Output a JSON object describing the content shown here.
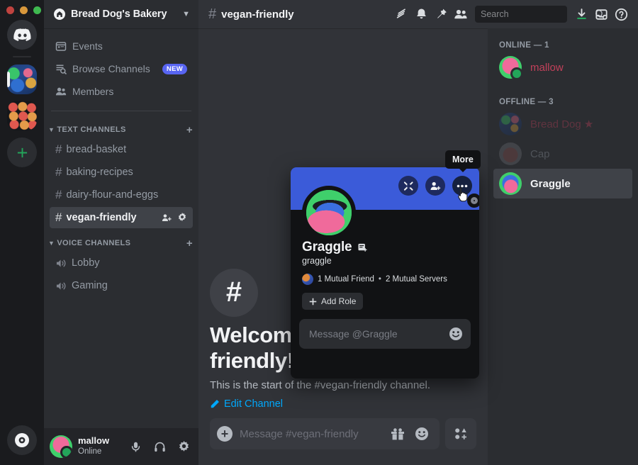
{
  "window": {
    "traffic_lights": [
      "close",
      "minimize",
      "maximize"
    ]
  },
  "server_rail": {
    "items": [
      {
        "name": "discord-home",
        "label": "Discord"
      },
      {
        "name": "server-bread-dogs-bakery",
        "label": "Bread Dog's Bakery",
        "active": true
      },
      {
        "name": "server-cookies",
        "label": "Cookies"
      },
      {
        "name": "add-server",
        "label": "Add a Server"
      },
      {
        "name": "explore-servers",
        "label": "Explore Discoverable Servers"
      }
    ]
  },
  "sidebar": {
    "server_name": "Bread Dog's Bakery",
    "nav": [
      {
        "label": "Events",
        "icon": "calendar-icon"
      },
      {
        "label": "Browse Channels",
        "icon": "browse-icon",
        "badge": "NEW"
      },
      {
        "label": "Members",
        "icon": "members-icon"
      }
    ],
    "categories": [
      {
        "label": "TEXT CHANNELS",
        "channels": [
          {
            "name": "bread-basket",
            "active": false
          },
          {
            "name": "baking-recipes",
            "active": false
          },
          {
            "name": "dairy-flour-and-eggs",
            "active": false
          },
          {
            "name": "vegan-friendly",
            "active": true
          }
        ]
      },
      {
        "label": "VOICE CHANNELS",
        "channels": [
          {
            "name": "Lobby",
            "active": false
          },
          {
            "name": "Gaming",
            "active": false
          }
        ]
      }
    ],
    "user_panel": {
      "username": "mallow",
      "status": "Online",
      "buttons": [
        "microphone-icon",
        "headphones-icon",
        "settings-icon"
      ]
    }
  },
  "topbar": {
    "channel": "vegan-friendly",
    "icons": [
      "threads-icon",
      "notification-bell-icon",
      "pinned-messages-icon",
      "member-list-icon"
    ],
    "search": {
      "placeholder": "Search",
      "value": ""
    },
    "right_icons": [
      "inbox-download-icon",
      "inbox-icon",
      "help-icon"
    ]
  },
  "main": {
    "welcome_title": "Welcome to #vegan-friendly!",
    "welcome_subtitle": "This is the start of the #vegan-friendly channel.",
    "edit_channel": "Edit Channel",
    "composer": {
      "placeholder": "Message #vegan-friendly",
      "icons": [
        "gift-icon",
        "emoji-icon",
        "apps-icon"
      ]
    }
  },
  "members": {
    "groups": [
      {
        "heading": "ONLINE — 1",
        "items": [
          {
            "name": "mallow",
            "color": "#c2405a",
            "avatar": "av-mallow",
            "online": true,
            "selected": false,
            "dim": false
          }
        ]
      },
      {
        "heading": "OFFLINE — 3",
        "items": [
          {
            "name": "Bread Dog ★",
            "color": "#c2405a",
            "avatar": "av-breaddog",
            "online": false,
            "selected": false,
            "dim": true
          },
          {
            "name": "Cap",
            "color": "#949ba4",
            "avatar": "av-cap",
            "online": false,
            "selected": false,
            "dim": true
          },
          {
            "name": "Graggle",
            "color": "#f2f3f5",
            "avatar": "av-graggle",
            "online": false,
            "selected": true,
            "dim": false
          }
        ]
      }
    ]
  },
  "profile_popout": {
    "banner_color": "#3b5bd9",
    "display_name": "Graggle",
    "handle": "graggle",
    "mutual_friends": "1 Mutual Friend",
    "separator": "•",
    "mutual_servers": "2 Mutual Servers",
    "add_role": "Add Role",
    "message_placeholder": "Message @Graggle",
    "actions": [
      {
        "name": "call-icon",
        "label": "Call"
      },
      {
        "name": "add-friend-icon",
        "label": "Add Friend"
      },
      {
        "name": "more-icon",
        "label": "More"
      }
    ]
  },
  "tooltip": {
    "text": "More"
  }
}
